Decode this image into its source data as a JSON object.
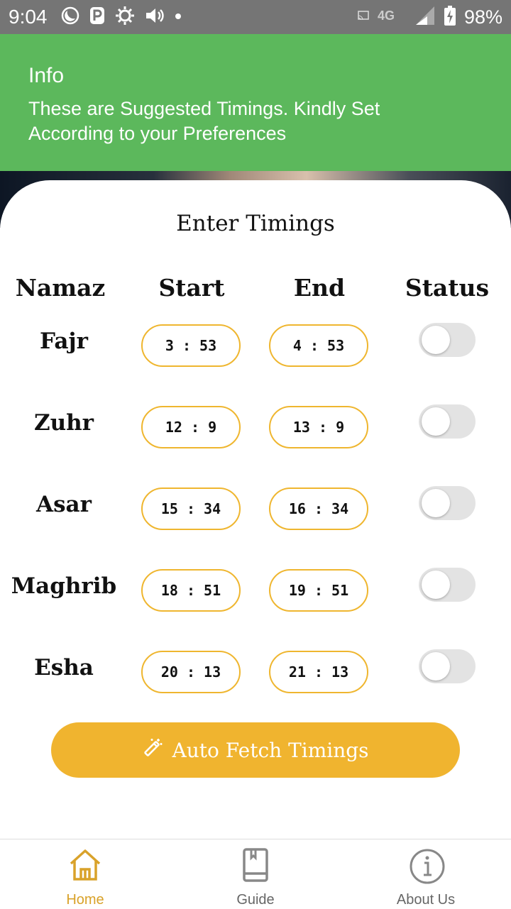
{
  "status_bar": {
    "time": "9:04",
    "battery": "98%",
    "icons_left": [
      "moon-icon",
      "parking-icon",
      "brightness-icon",
      "volume-icon",
      "dot-icon"
    ],
    "icons_right": [
      "cast-icon",
      "network-4g-icon",
      "signal-icon",
      "battery-charging-icon"
    ]
  },
  "banner": {
    "title": "Info",
    "message": "These are Suggested Timings. Kindly Set According to your Preferences",
    "color": "#5cb85c"
  },
  "card": {
    "title": "Enter Timings",
    "columns": {
      "namaz": "Namaz",
      "start": "Start",
      "end": "End",
      "status": "Status"
    },
    "rows": [
      {
        "name": "Fajr",
        "start": "3 : 53",
        "end": "4 : 53",
        "enabled": false
      },
      {
        "name": "Zuhr",
        "start": "12 : 9",
        "end": "13 : 9",
        "enabled": false
      },
      {
        "name": "Asar",
        "start": "15 : 34",
        "end": "16 : 34",
        "enabled": false
      },
      {
        "name": "Maghrib",
        "start": "18 : 51",
        "end": "19 : 51",
        "enabled": false
      },
      {
        "name": "Esha",
        "start": "20 : 13",
        "end": "21 : 13",
        "enabled": false
      }
    ],
    "fetch_button": {
      "label": "Auto Fetch Timings",
      "icon": "magic-wand-icon"
    },
    "accent": "#f0b42f"
  },
  "bottom_nav": {
    "items": [
      {
        "label": "Home",
        "icon": "home-icon",
        "active": true
      },
      {
        "label": "Guide",
        "icon": "book-icon",
        "active": false
      },
      {
        "label": "About Us",
        "icon": "info-icon",
        "active": false
      }
    ],
    "active_color": "#d9a22a"
  }
}
